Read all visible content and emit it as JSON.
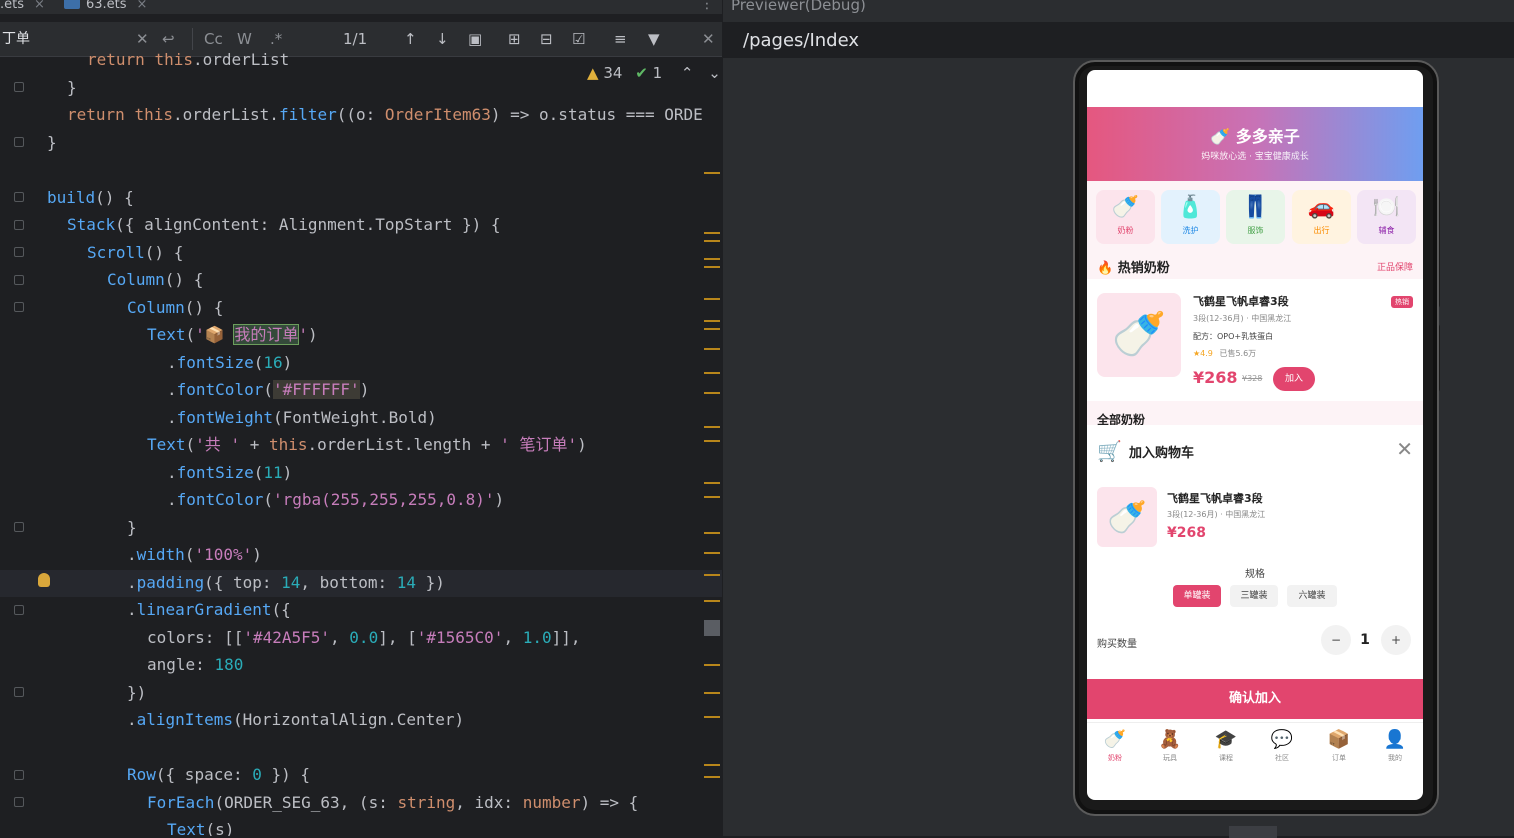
{
  "editor": {
    "tabs": [
      {
        "label": ".ets",
        "close": "×"
      },
      {
        "label": "63.ets",
        "close": "×"
      }
    ],
    "menu": "⋮",
    "find": {
      "query": "丁单",
      "match": "1/1",
      "cc": "Cc",
      "w": "W",
      "regex": ".*"
    },
    "inspections": {
      "warnings": "34",
      "ok": "1"
    },
    "lines": [
      "return this.orderList",
      "}",
      "return this.orderList.filter((o: OrderItem63) => o.status === ORDE",
      "}",
      "",
      "build() {",
      "Stack({ alignContent: Alignment.TopStart }) {",
      "Scroll() {",
      "Column() {",
      "Column() {",
      "Text('📦 我的订单')",
      ".fontSize(16)",
      ".fontColor('#FFFFFF')",
      ".fontWeight(FontWeight.Bold)",
      "Text('共 ' + this.orderList.length + ' 笔订单')",
      ".fontSize(11)",
      ".fontColor('rgba(255,255,255,0.8)')",
      "}",
      ".width('100%')",
      ".padding({ top: 14, bottom: 14 })",
      ".linearGradient({",
      "colors: [['#42A5F5', 0.0], ['#1565C0', 1.0]],",
      "angle: 180",
      "})",
      ".alignItems(HorizontalAlign.Center)",
      "",
      "Row({ space: 0 }) {",
      "ForEach(ORDER_SEG_63, (s: string, idx: number) => {",
      "Text(s)"
    ]
  },
  "previewer": {
    "title": "Previewer(Debug)",
    "path": "/pages/Index"
  },
  "app": {
    "header": {
      "title": "🍼 多多亲子",
      "subtitle": "妈咪放心选 · 宝宝健康成长"
    },
    "categories": [
      {
        "icon": "🍼",
        "label": "奶粉",
        "bg": "#fce4ec",
        "color": "#e2456e"
      },
      {
        "icon": "🧴",
        "label": "洗护",
        "bg": "#e3f2fd",
        "color": "#1e88e5"
      },
      {
        "icon": "👖",
        "label": "服饰",
        "bg": "#e8f5e9",
        "color": "#43a047"
      },
      {
        "icon": "🚗",
        "label": "出行",
        "bg": "#fff3e0",
        "color": "#fb8c00"
      },
      {
        "icon": "🍽️",
        "label": "辅食",
        "bg": "#f3e5f5",
        "color": "#8e24aa"
      }
    ],
    "hot_section": {
      "icon": "🔥",
      "title": "热销奶粉",
      "link": "正品保障"
    },
    "product": {
      "image": "🍼",
      "name": "飞鹤星飞帆卓睿3段",
      "badge": "热销",
      "spec": "3段(12-36月) · 中国黑龙江",
      "formula": "配方：OPO+乳铁蛋白",
      "rating": "★4.9",
      "sold": "已售5.6万",
      "price": "¥268",
      "old_price": "¥328",
      "add": "加入"
    },
    "all_section": {
      "title": "全部奶粉"
    },
    "sheet": {
      "title": "加入购物车",
      "close": "✕",
      "name": "飞鹤星飞帆卓睿3段",
      "spec": "3段(12-36月) · 中国黑龙江",
      "price": "¥268",
      "spec_label": "规格",
      "options": [
        "单罐装",
        "三罐装",
        "六罐装"
      ],
      "selected_option": "单罐装",
      "qty_label": "购买数量",
      "minus": "−",
      "qty": "1",
      "plus": "+",
      "confirm": "确认加入"
    },
    "tabs": [
      {
        "icon": "🍼",
        "label": "奶粉",
        "active": true
      },
      {
        "icon": "🧸",
        "label": "玩具",
        "active": false
      },
      {
        "icon": "🎓",
        "label": "课程",
        "active": false
      },
      {
        "icon": "💬",
        "label": "社区",
        "active": false
      },
      {
        "icon": "📦",
        "label": "订单",
        "active": false
      },
      {
        "icon": "👤",
        "label": "我的",
        "active": false
      }
    ],
    "accent": "#e2456e"
  }
}
